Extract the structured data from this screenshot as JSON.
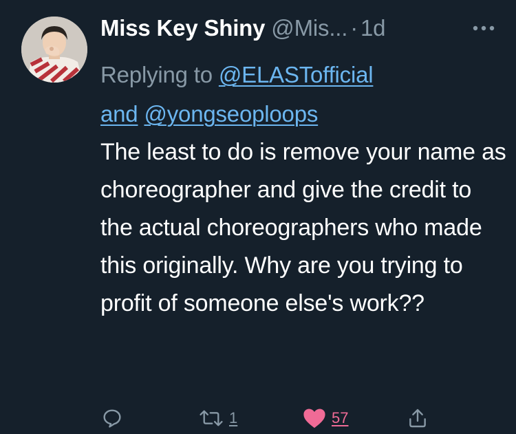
{
  "tweet": {
    "display_name": "Miss Key Shiny",
    "handle": "@Mis...",
    "separator": "·",
    "time": "1d",
    "more_icon": "more-horizontal-icon",
    "reply_prefix": "Replying to",
    "reply_mention_1": "@ELASTofficial",
    "reply_and": "and",
    "reply_mention_2": "@yongseoploops",
    "text": "The least to do is remove your name as choreographer and give the credit to the actual choreographers who made this originally. Why are you trying to profit of someone else's work??"
  },
  "actions": {
    "reply_icon": "reply-icon",
    "retweet_icon": "retweet-icon",
    "retweet_count": "1",
    "like_icon": "heart-filled-icon",
    "like_count": "57",
    "share_icon": "share-icon"
  },
  "colors": {
    "background": "#15202b",
    "secondary_text": "#8899a6",
    "link": "#6cb6f0",
    "like": "#f06b96"
  }
}
